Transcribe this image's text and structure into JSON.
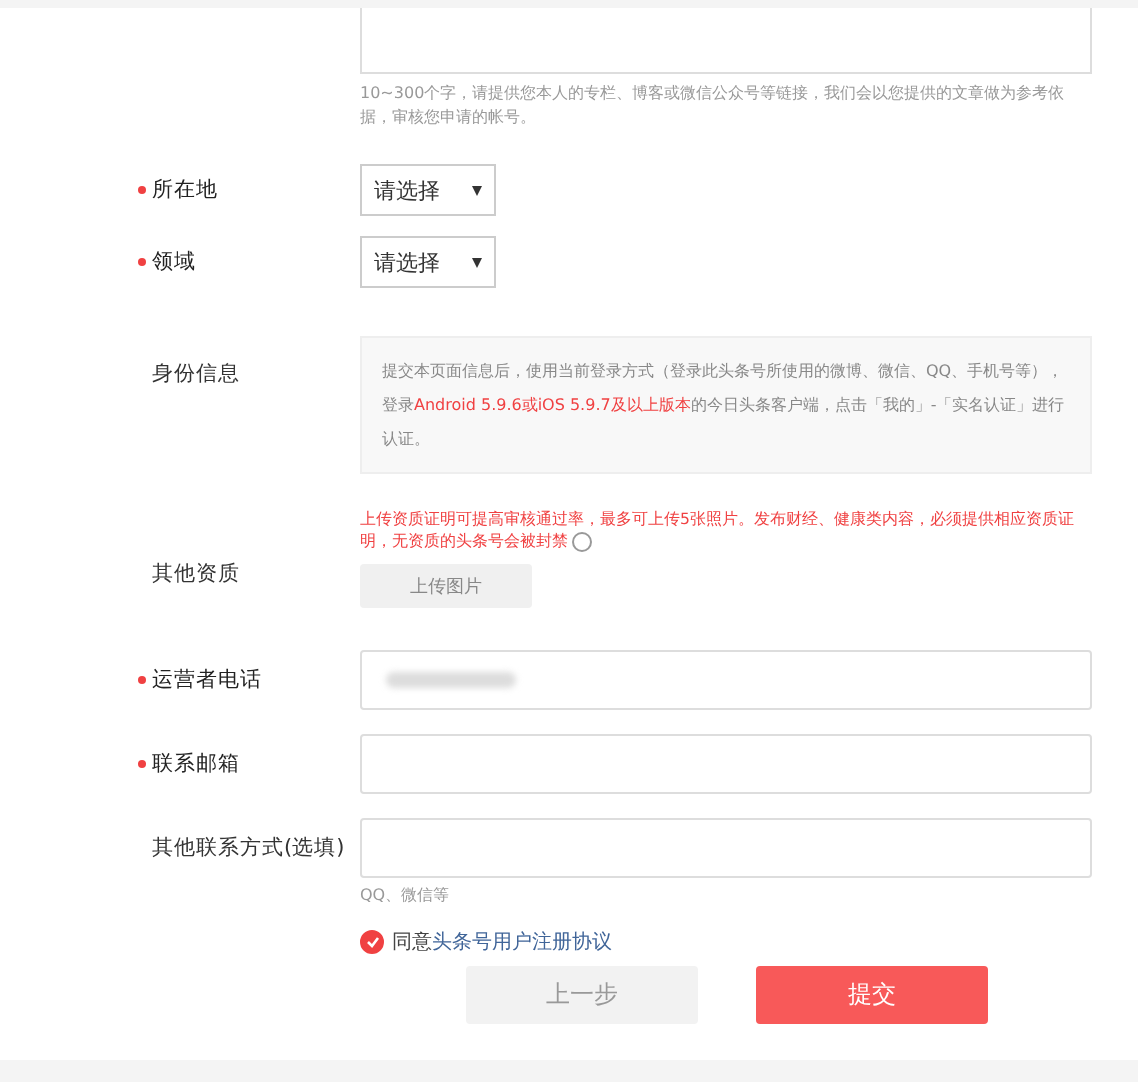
{
  "intro_hint": "10~300个字，请提供您本人的专栏、博客或微信公众号等链接，我们会以您提供的文章做为参考依据，审核您申请的帐号。",
  "selects": [
    {
      "label": "所在地",
      "required": true,
      "value": "请选择"
    },
    {
      "label": "领域",
      "required": true,
      "value": "请选择"
    }
  ],
  "identity": {
    "label": "身份信息",
    "segments": [
      {
        "text": "提交本页面信息后，使用当前登录方式（登录此头条号所使用的微博、微信、QQ、手机号等），登录",
        "highlight": false
      },
      {
        "text": "Android 5.9.6或iOS 5.9.7及以上版本",
        "highlight": true
      },
      {
        "text": "的今日头条客户端，点击「我的」-「实名认证」进行认证。",
        "highlight": false
      }
    ]
  },
  "qualification": {
    "label": "其他资质",
    "warning": "上传资质证明可提高审核通过率，最多可上传5张照片。发布财经、健康类内容，必须提供相应资质证明，无资质的头条号会被封禁",
    "upload_button": "上传图片"
  },
  "inputs": [
    {
      "label": "运营者电话",
      "required": true,
      "value_redacted": true
    },
    {
      "label": "联系邮箱",
      "required": true,
      "value_redacted": false
    },
    {
      "label": "其他联系方式(选填)",
      "required": false,
      "value_redacted": false,
      "hint": "QQ、微信等"
    }
  ],
  "agreement": {
    "checked": true,
    "text": "同意",
    "link": "头条号用户注册协议"
  },
  "buttons": [
    {
      "label": "上一步",
      "kind": "secondary"
    },
    {
      "label": "提交",
      "kind": "primary"
    }
  ]
}
